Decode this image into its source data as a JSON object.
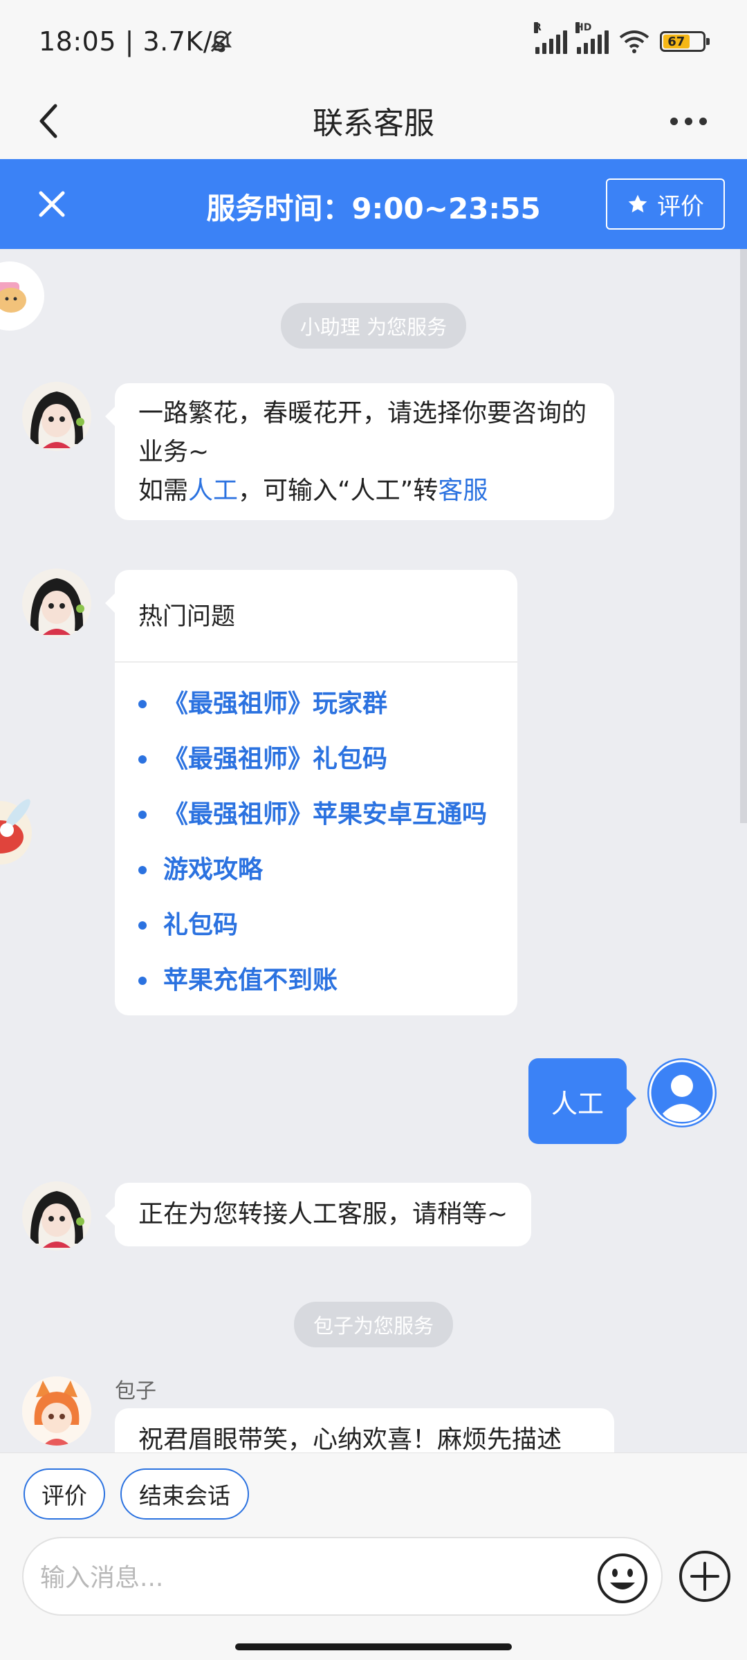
{
  "status_bar": {
    "time_speed": "18:05 | 3.7K/s",
    "signal1_tag": "R",
    "signal2_tag": "HD",
    "battery": "67"
  },
  "header": {
    "title": "联系客服"
  },
  "banner": {
    "service_hours": "服务时间：9:00~23:55",
    "rate_label": "评价"
  },
  "chat": {
    "system_1": "小助理 为您服务",
    "welcome": {
      "line1": "一路繁花，春暖花开，请选择你要咨询的业务~",
      "prefix": "如需",
      "link_human": "人工",
      "middle": "，可输入“人工”转",
      "link_service": "客服"
    },
    "faq": {
      "title": "热门问题",
      "items": [
        "《最强祖师》玩家群",
        "《最强祖师》礼包码",
        "《最强祖师》苹果安卓互通吗",
        "游戏攻略",
        "礼包码",
        "苹果充值不到账"
      ]
    },
    "user_message": "人工",
    "transfer_message": "正在为您转接人工客服，请稍等~",
    "system_2": "包子为您服务",
    "agent_name": "包子",
    "agent_message": "祝君眉眼带笑，心纳欢喜！麻烦先描述"
  },
  "quick_actions": {
    "rate": "评价",
    "end": "结束会话"
  },
  "input": {
    "placeholder": "输入消息..."
  },
  "colors": {
    "accent": "#3b82f6",
    "link": "#2b72e0",
    "background": "#ecedf1"
  }
}
